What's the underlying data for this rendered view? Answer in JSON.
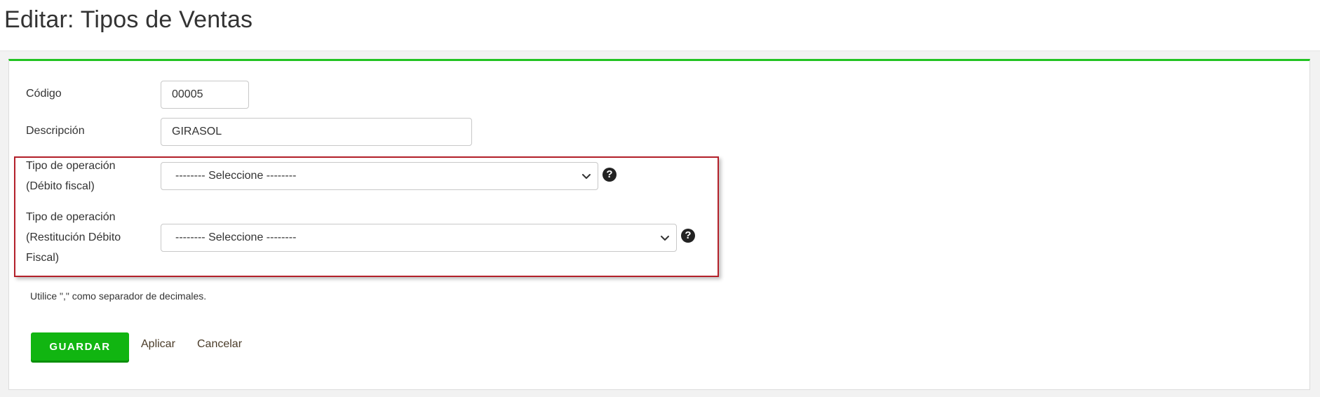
{
  "header": {
    "title": "Editar: Tipos de Ventas"
  },
  "form": {
    "codigo": {
      "label": "Código",
      "value": "00005"
    },
    "descripcion": {
      "label": "Descripción",
      "value": "GIRASOL"
    },
    "tipo_operacion_debito": {
      "label_line1": "Tipo de operación",
      "label_line2": "(Débito fiscal)",
      "selected": "-------- Seleccione --------",
      "help_icon": "question-circle-icon"
    },
    "tipo_operacion_restitucion": {
      "label_line1": "Tipo de operación",
      "label_line2": "(Restitución Débito",
      "label_line3": "Fiscal)",
      "selected": "-------- Seleccione --------",
      "help_icon": "question-circle-icon"
    },
    "hint": "Utilice \",\" como separador de decimales."
  },
  "actions": {
    "save_label": "GUARDAR",
    "apply_label": "Aplicar",
    "cancel_label": "Cancelar"
  },
  "colors": {
    "panel_accent": "#22c322",
    "save_button": "#11b511",
    "highlight_border": "#b3202a"
  }
}
